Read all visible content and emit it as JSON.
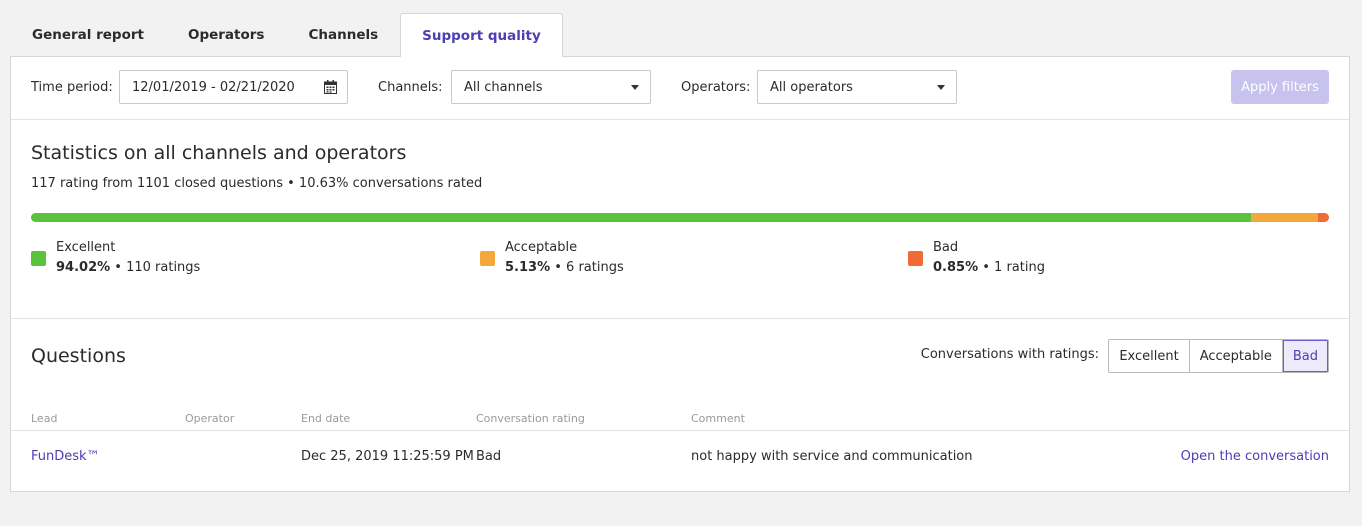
{
  "tabs": [
    {
      "label": "General report"
    },
    {
      "label": "Operators"
    },
    {
      "label": "Channels"
    },
    {
      "label": "Support quality"
    }
  ],
  "filters": {
    "time_period_label": "Time period:",
    "time_period_value": "12/01/2019 - 02/21/2020",
    "channels_label": "Channels:",
    "channels_value": "All channels",
    "operators_label": "Operators:",
    "operators_value": "All operators",
    "apply_label": "Apply filters"
  },
  "stats": {
    "title": "Statistics on all channels and operators",
    "summary": "117 rating from 1101 closed questions • 10.63% conversations rated",
    "breakdown": [
      {
        "name": "Excellent",
        "percent_text": "94.02%",
        "count_text": " • 110 ratings",
        "fraction": 0.9402,
        "color": "#5bc23c"
      },
      {
        "name": "Acceptable",
        "percent_text": "5.13%",
        "count_text": " • 6 ratings",
        "fraction": 0.0513,
        "color": "#f2a83b"
      },
      {
        "name": "Bad",
        "percent_text": "0.85%",
        "count_text": " • 1 rating",
        "fraction": 0.0085,
        "color": "#ef6a34"
      }
    ]
  },
  "questions": {
    "title": "Questions",
    "ratings_label": "Conversations with ratings:",
    "rating_filters": [
      "Excellent",
      "Acceptable",
      "Bad"
    ],
    "selected_filter": "Bad",
    "columns": [
      "Lead",
      "Operator",
      "End date",
      "Conversation rating",
      "Comment"
    ],
    "rows": [
      {
        "lead": "FunDesk™",
        "operator": "",
        "end_date": "Dec 25, 2019 11:25:59 PM",
        "rating": "Bad",
        "comment": "not happy with service and communication",
        "action": "Open the conversation"
      }
    ]
  },
  "colors": {
    "accent": "#4b3fb3",
    "apply_disabled": "#c7c2ee"
  }
}
